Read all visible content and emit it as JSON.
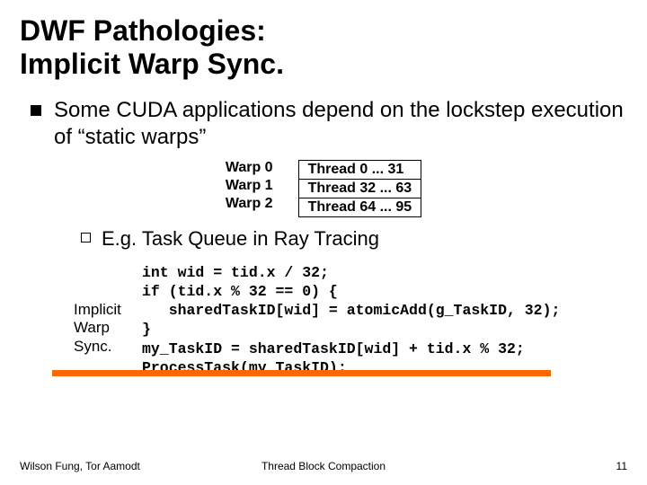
{
  "title_line1": "DWF Pathologies:",
  "title_line2": "Implicit Warp Sync.",
  "bullet1_text": "Some CUDA applications depend on the lockstep execution of “static warps”",
  "warps": {
    "labels": [
      "Warp 0",
      "Warp 1",
      "Warp 2"
    ],
    "threads": [
      "Thread   0 ... 31",
      "Thread 32 ... 63",
      "Thread 64 ... 95"
    ]
  },
  "bullet2_text": "E.g. Task Queue in Ray Tracing",
  "code_label_l1": "Implicit",
  "code_label_l2": "Warp",
  "code_label_l3": "Sync.",
  "code": {
    "l1": "int wid = tid.x / 32;",
    "l2": "if (tid.x % 32 == 0) {",
    "l3": "   sharedTaskID[wid] = atomicAdd(g_TaskID, 32);",
    "l4": "}",
    "l5": "my_TaskID = sharedTaskID[wid] + tid.x % 32;",
    "l6": "ProcessTask(my_TaskID);"
  },
  "footer": {
    "left": "Wilson Fung, Tor Aamodt",
    "center": "Thread Block Compaction",
    "right": "11"
  }
}
